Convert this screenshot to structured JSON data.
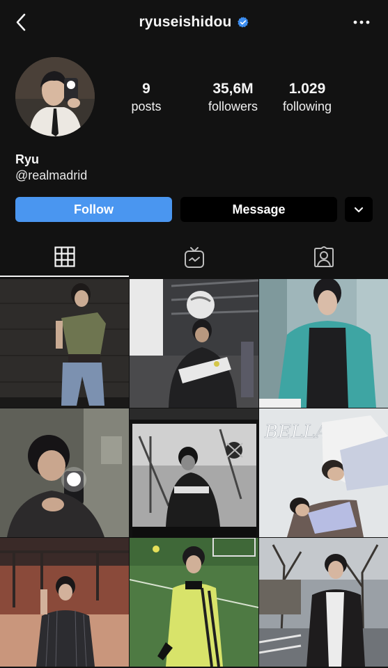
{
  "header": {
    "username": "ryuseishidou",
    "verified_icon": "verified-badge-icon",
    "back_icon": "chevron-left-icon",
    "more_icon": "more-horizontal-icon"
  },
  "profile": {
    "stats": [
      {
        "value": "9",
        "label": "posts"
      },
      {
        "value": "35,6M",
        "label": "followers"
      },
      {
        "value": "1.029",
        "label": "following"
      }
    ],
    "name": "Ryu",
    "bio_handle": "@realmadrid"
  },
  "actions": {
    "follow_label": "Follow",
    "message_label": "Message",
    "dropdown_icon": "chevron-down-icon"
  },
  "tabs": [
    {
      "icon": "grid-icon",
      "active": true
    },
    {
      "icon": "igtv-icon",
      "active": false
    },
    {
      "icon": "tagged-person-icon",
      "active": false
    }
  ],
  "posts": {
    "overlay_texts": [
      "BELLA"
    ],
    "count": 9
  },
  "colors": {
    "background": "#121212",
    "accent": "#4a96f0",
    "verified": "#3d8ef0"
  }
}
